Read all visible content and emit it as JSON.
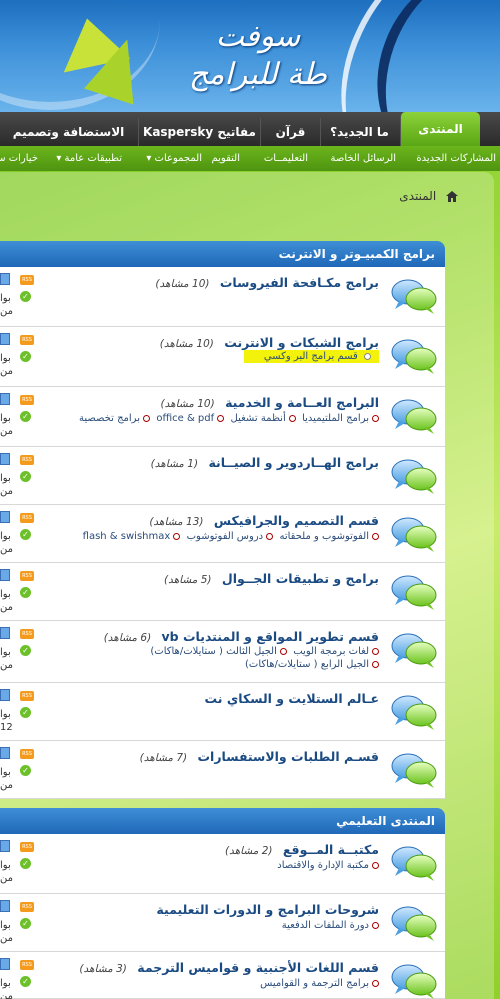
{
  "logo": {
    "text_line1": "سوفت",
    "text_line2": "طة للبرامج"
  },
  "nav": {
    "tabs": [
      {
        "label": "المنتدى",
        "active": true
      },
      {
        "label": "ما الجديد؟"
      },
      {
        "label": "قرآن"
      },
      {
        "label": "مفاتيح Kaspersky"
      },
      {
        "label": "الاستضافة وتصميم"
      }
    ]
  },
  "subnav": {
    "items": [
      "المشاركات الجديدة",
      "الرسائل الخاصة",
      "التعليمــات",
      "التقويم",
      "المجموعات ▾",
      "تطبيقات عامة ▾",
      "خيارات س"
    ]
  },
  "breadcrumb": {
    "label": "المنتدى"
  },
  "sections": [
    {
      "title": "برامج الكمبيـوتر و الانترنت",
      "forums": [
        {
          "title": "برامج مكـافحة الفيروسات",
          "views": "(10 مشاهد)",
          "subs": []
        },
        {
          "title": "برامج الشبكات و الانترنت",
          "views": "(10 مشاهد)",
          "subs": [
            "قسم برامج البر وكسي"
          ],
          "highlight_sub": true
        },
        {
          "title": "البرامج العــامة و الخدمية",
          "views": "(10 مشاهد)",
          "subs": [
            "برامج الملتيميديا",
            "أنظمة تشغيل",
            "office & pdf",
            "برامج تخصصية"
          ]
        },
        {
          "title": "برامج الهــاردوير و الصيــانة",
          "views": "(1 مشاهد)",
          "subs": []
        },
        {
          "title": "قسم التصميم والجرافيكس",
          "views": "(13 مشاهد)",
          "subs": [
            "الفوتوشوب و ملحقاته",
            "دروس الفوتوشوب",
            "flash & swishmax"
          ]
        },
        {
          "title": "برامج و تطبيقات الجــوال",
          "views": "(5 مشاهد)",
          "subs": []
        },
        {
          "title": "قسم تطوير المواقع و المنتديات vb",
          "views": "(6 مشاهد)",
          "subs": [
            "لغات برمجة الويب",
            "الجيل الثالث ( ستايلات/هاكات)",
            "الجيل الرابع ( ستايلات/هاكات)"
          ]
        },
        {
          "title": "عـالم الستلايت و السكاي نت",
          "views": "",
          "subs": []
        },
        {
          "title": "قسـم الطلبات والاستفسارات",
          "views": "(7 مشاهد)",
          "subs": []
        }
      ]
    },
    {
      "title": "المنتدى التعليمي",
      "forums": [
        {
          "title": "مكتبــة المــوقع",
          "views": "(2 مشاهد)",
          "subs": [
            "مكتبة الإدارة والاقتصاد"
          ]
        },
        {
          "title": "شروحات البرامج و الدورات التعليمية",
          "views": "",
          "subs": [
            "دورة الملفات الدفعية"
          ]
        },
        {
          "title": "قسم اللغات الأجنبية و قواميس الترجمة",
          "views": "(3 مشاهد)",
          "subs": [
            "برامج الترجمة و القواميس"
          ]
        }
      ]
    }
  ],
  "side": {
    "text_a": "بوا",
    "text_b": "من",
    "text_c": "12",
    "rss_label": "RSS"
  },
  "colors": {
    "nav_active": "#6cbe1e",
    "section_header": "#2a78c8",
    "title_link": "#1a4a82",
    "highlight": "#f2f20a"
  }
}
